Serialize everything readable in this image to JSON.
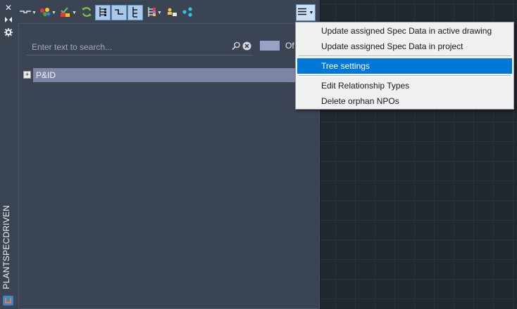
{
  "side_strip": {
    "title": "PLANTSPECDRIVEN",
    "buttons": [
      "close-icon",
      "auto-hide-icon",
      "properties-icon"
    ]
  },
  "toolbar": {
    "tools": [
      "connector-style-icon",
      "color-dots-icon",
      "validate-check-icon",
      "refresh-icon",
      "tree-view-icon",
      "flat-view-icon",
      "indent-view-icon",
      "hierarchy-options-icon",
      "assign-user-icon",
      "network-icon"
    ],
    "menu_icon": "hamburger-icon"
  },
  "search": {
    "placeholder": "Enter text to search...",
    "value": ""
  },
  "filter": {
    "label": "Of"
  },
  "tree": {
    "items": [
      {
        "label": "P&ID",
        "expander": "+"
      }
    ]
  },
  "dropdown": {
    "items": [
      {
        "label": "Update assigned Spec Data in active drawing"
      },
      {
        "label": "Update assigned Spec Data in project"
      },
      {
        "label": "Tree settings",
        "highlighted": true
      },
      {
        "label": "Edit Relationship Types"
      },
      {
        "label": "Delete orphan NPOs"
      }
    ]
  },
  "colors": {
    "panel": "#3b4453",
    "canvas": "#212830",
    "highlight": "#0078d7",
    "tree_selection": "#7d85a6"
  }
}
